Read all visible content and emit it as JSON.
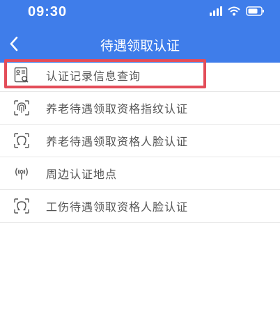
{
  "status_bar": {
    "time": "09:30"
  },
  "header": {
    "title": "待遇领取认证",
    "back_icon": "chevron-left-icon"
  },
  "menu": {
    "items": [
      {
        "label": "认证记录信息查询",
        "icon": "record-search-icon"
      },
      {
        "label": "养老待遇领取资格指纹认证",
        "icon": "fingerprint-icon"
      },
      {
        "label": "养老待遇领取资格人脸认证",
        "icon": "face-scan-icon"
      },
      {
        "label": "周边认证地点",
        "icon": "location-signal-icon"
      },
      {
        "label": "工伤待遇领取资格人脸认证",
        "icon": "face-scan-icon"
      }
    ]
  },
  "colors": {
    "header_bg": "#3f7dea",
    "highlight": "#e34d59",
    "text": "#555555"
  }
}
